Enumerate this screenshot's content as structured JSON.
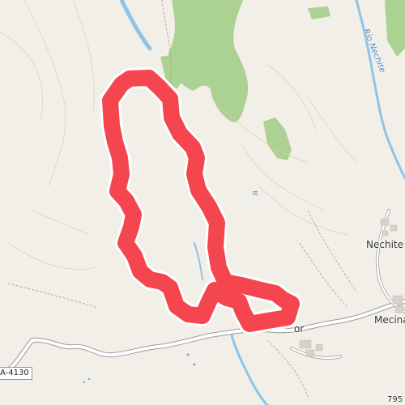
{
  "map": {
    "places": {
      "nechite": "Nechite",
      "mecina": "Mecina",
      "partial_town": "or",
      "partial_number": "795"
    },
    "river": {
      "name": "Río Nechite"
    },
    "road": {
      "ref": "A-4130"
    },
    "colors": {
      "background": "#f2efe9",
      "forest": "#9dcc8a",
      "river": "#8fc4e6",
      "route": "#f5454f",
      "road_outline": "#9a9a9a"
    }
  }
}
